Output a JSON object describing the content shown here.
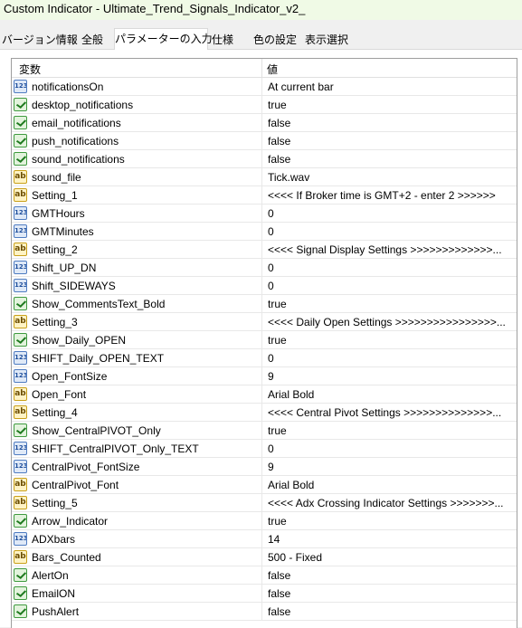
{
  "window": {
    "title": "Custom Indicator - Ultimate_Trend_Signals_Indicator_v2_"
  },
  "tabs": [
    {
      "label": "バージョン情報"
    },
    {
      "label": "全般"
    },
    {
      "label": "パラメーターの入力",
      "active": true
    },
    {
      "label": "仕様"
    },
    {
      "label": "色の設定"
    },
    {
      "label": "表示選択"
    }
  ],
  "grid": {
    "header": {
      "variable": "変数",
      "value": "値"
    },
    "rows": [
      {
        "icon": "numeric-icon",
        "name": "notificationsOn",
        "value": "At current bar"
      },
      {
        "icon": "boolean-icon",
        "name": "desktop_notifications",
        "value": "true"
      },
      {
        "icon": "boolean-icon",
        "name": "email_notifications",
        "value": "false"
      },
      {
        "icon": "boolean-icon",
        "name": "push_notifications",
        "value": "false"
      },
      {
        "icon": "boolean-icon",
        "name": "sound_notifications",
        "value": "false"
      },
      {
        "icon": "string-icon",
        "name": "sound_file",
        "value": "Tick.wav"
      },
      {
        "icon": "string-icon",
        "name": "Setting_1",
        "value": "<<<< If Broker time is GMT+2 - enter 2 >>>>>>"
      },
      {
        "icon": "numeric-icon",
        "name": "GMTHours",
        "value": "0"
      },
      {
        "icon": "numeric-icon",
        "name": "GMTMinutes",
        "value": "0"
      },
      {
        "icon": "string-icon",
        "name": "Setting_2",
        "value": "<<<< Signal Display Settings >>>>>>>>>>>>>..."
      },
      {
        "icon": "numeric-icon",
        "name": "Shift_UP_DN",
        "value": "0"
      },
      {
        "icon": "numeric-icon",
        "name": "Shift_SIDEWAYS",
        "value": "0"
      },
      {
        "icon": "boolean-icon",
        "name": "Show_CommentsText_Bold",
        "value": "true"
      },
      {
        "icon": "string-icon",
        "name": "Setting_3",
        "value": "<<<< Daily Open Settings >>>>>>>>>>>>>>>>..."
      },
      {
        "icon": "boolean-icon",
        "name": "Show_Daily_OPEN",
        "value": "true"
      },
      {
        "icon": "numeric-icon",
        "name": "SHIFT_Daily_OPEN_TEXT",
        "value": "0"
      },
      {
        "icon": "numeric-icon",
        "name": "Open_FontSize",
        "value": "9"
      },
      {
        "icon": "string-icon",
        "name": "Open_Font",
        "value": "Arial Bold"
      },
      {
        "icon": "string-icon",
        "name": "Setting_4",
        "value": "<<<< Central Pivot Settings >>>>>>>>>>>>>>..."
      },
      {
        "icon": "boolean-icon",
        "name": "Show_CentralPIVOT_Only",
        "value": "true"
      },
      {
        "icon": "numeric-icon",
        "name": "SHIFT_CentralPIVOT_Only_TEXT",
        "value": "0"
      },
      {
        "icon": "numeric-icon",
        "name": "CentralPivot_FontSize",
        "value": "9"
      },
      {
        "icon": "string-icon",
        "name": "CentralPivot_Font",
        "value": "Arial Bold"
      },
      {
        "icon": "string-icon",
        "name": "Setting_5",
        "value": "<<<< Adx Crossing Indicator Settings >>>>>>>..."
      },
      {
        "icon": "boolean-icon",
        "name": "Arrow_Indicator",
        "value": "true"
      },
      {
        "icon": "numeric-icon",
        "name": "ADXbars",
        "value": "14"
      },
      {
        "icon": "string-icon",
        "name": "Bars_Counted",
        "value": "500 - Fixed"
      },
      {
        "icon": "boolean-icon",
        "name": "AlertOn",
        "value": "false"
      },
      {
        "icon": "boolean-icon",
        "name": "EmailON",
        "value": "false"
      },
      {
        "icon": "boolean-icon",
        "name": "PushAlert",
        "value": "false"
      }
    ]
  },
  "colors": {
    "title_bar": "#f0fae6",
    "numeric_icon": "#4f7cc1",
    "boolean_icon": "#3f9a3f",
    "string_icon": "#c9a019"
  }
}
